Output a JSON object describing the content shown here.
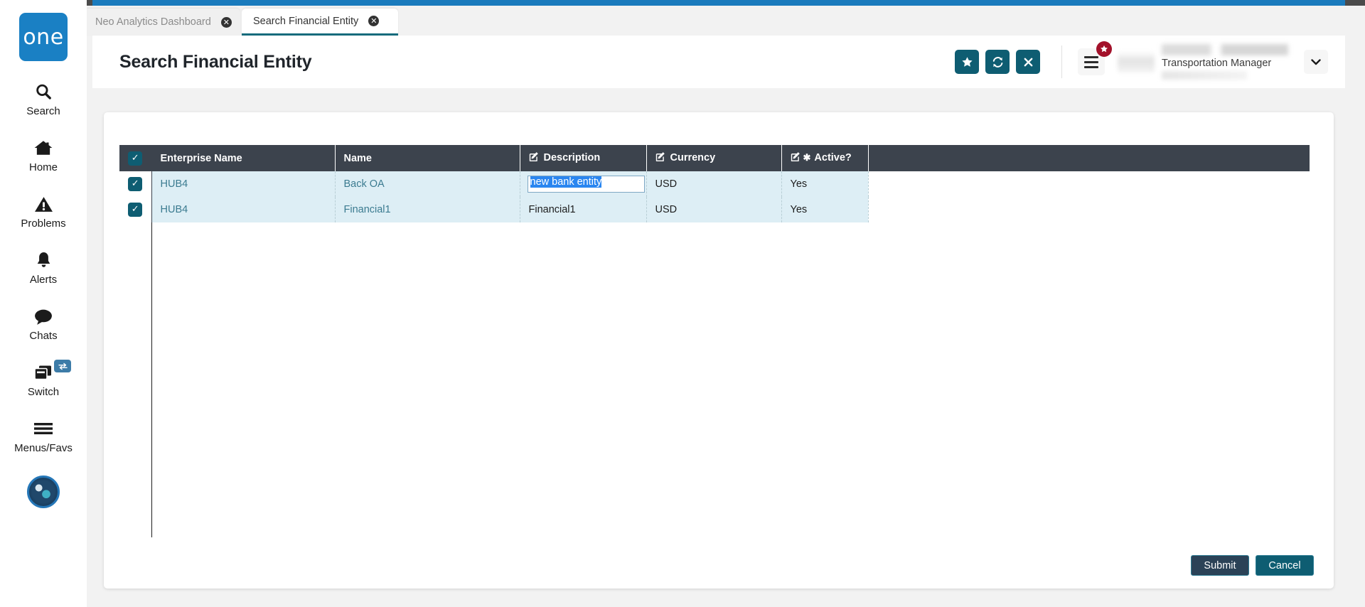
{
  "app": {
    "logo_text": "one",
    "accent_blue": "#1a7bbd",
    "teal": "#0e5d72",
    "header_dark": "#3c434d",
    "row_bg": "#ddeef5"
  },
  "sidebar": {
    "items": [
      {
        "label": "Search",
        "icon": "search-icon"
      },
      {
        "label": "Home",
        "icon": "home-icon"
      },
      {
        "label": "Problems",
        "icon": "warning-triangle-icon"
      },
      {
        "label": "Alerts",
        "icon": "bell-icon"
      },
      {
        "label": "Chats",
        "icon": "chat-bubble-icon"
      },
      {
        "label": "Switch",
        "icon": "windows-stack-icon",
        "badge_icon": "swap-arrows-icon"
      },
      {
        "label": "Menus/Favs",
        "icon": "hamburger-icon"
      }
    ],
    "avatar_icon": "user-avatar-image"
  },
  "tabs": [
    {
      "label": "Neo Analytics Dashboard",
      "active": false,
      "close_icon": "close-circle-icon"
    },
    {
      "label": "Search Financial Entity",
      "active": true,
      "close_icon": "close-circle-icon"
    }
  ],
  "header": {
    "title": "Search Financial Entity",
    "actions": [
      {
        "name": "favorite-button",
        "icon": "star-icon",
        "glyph": "★"
      },
      {
        "name": "refresh-button",
        "icon": "refresh-icon",
        "glyph": "↻"
      },
      {
        "name": "close-button",
        "icon": "close-x-icon",
        "glyph": "✕"
      }
    ],
    "menu_icon": "hamburger-icon",
    "favorites_badge_icon": "star-badge-icon",
    "favorites_badge_glyph": "★",
    "user_role": "Transportation Manager",
    "user_caret_icon": "chevron-down-icon",
    "user_caret_glyph": "⌄"
  },
  "table": {
    "select_all_icon": "checkmark-icon",
    "select_all_glyph": "✓",
    "columns": [
      {
        "label": "Enterprise Name",
        "editable": false,
        "required": false
      },
      {
        "label": "Name",
        "editable": false,
        "required": false
      },
      {
        "label": "Description",
        "editable": true,
        "required": false,
        "edit_icon": "pencil-square-icon"
      },
      {
        "label": "Currency",
        "editable": true,
        "required": false,
        "edit_icon": "pencil-square-icon"
      },
      {
        "label": "Active?",
        "editable": true,
        "required": true,
        "edit_icon": "pencil-square-icon",
        "required_glyph": "✱"
      }
    ],
    "rows": [
      {
        "checked": true,
        "checkbox_icon": "checkmark-icon",
        "checkbox_glyph": "✓",
        "enterprise_name": "HUB4",
        "name": "Back OA",
        "description": "new bank entity",
        "description_editing": true,
        "description_selected": true,
        "currency": "USD",
        "active": "Yes"
      },
      {
        "checked": true,
        "checkbox_icon": "checkmark-icon",
        "checkbox_glyph": "✓",
        "enterprise_name": "HUB4",
        "name": "Financial1",
        "description": "Financial1",
        "description_editing": false,
        "description_selected": false,
        "currency": "USD",
        "active": "Yes"
      }
    ]
  },
  "footer": {
    "submit_label": "Submit",
    "cancel_label": "Cancel"
  }
}
